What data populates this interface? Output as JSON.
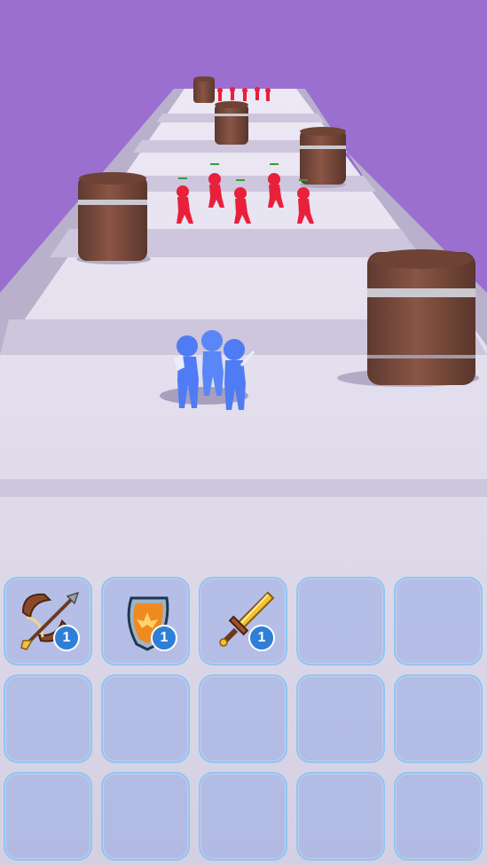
{
  "scene": {
    "player_team": {
      "color": "#4f7bf5",
      "count": 3
    },
    "enemy_team": {
      "color": "#e8203a",
      "count": 6
    },
    "colors": {
      "sky": "#9a6fd0",
      "road": "#d9d3e6",
      "barrel": "#7a4a3a",
      "barrel_band": "#c9c9cf"
    }
  },
  "inventory": {
    "rows": 3,
    "columns": 5,
    "items": [
      {
        "name": "bow",
        "icon": "bow-and-arrow-icon",
        "level": "1"
      },
      {
        "name": "shield",
        "icon": "shield-icon",
        "level": "1"
      },
      {
        "name": "sword",
        "icon": "sword-icon",
        "level": "1"
      }
    ]
  }
}
